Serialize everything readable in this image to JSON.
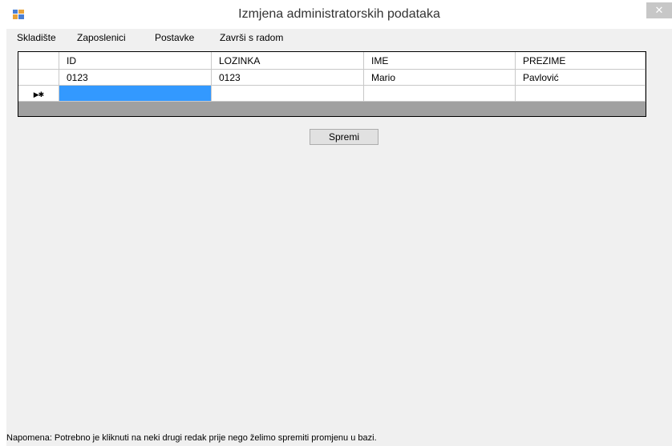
{
  "window": {
    "title": "Izmjena administratorskih podataka",
    "close_glyph": "✕"
  },
  "menu": [
    {
      "label": "Skladište"
    },
    {
      "label": "Zaposlenici"
    },
    {
      "label": "Postavke"
    },
    {
      "label": "Završi s radom"
    }
  ],
  "grid": {
    "columns": [
      "ID",
      "LOZINKA",
      "IME",
      "PREZIME"
    ],
    "rows": [
      [
        "0123",
        "0123",
        "Mario",
        "Pavlović"
      ]
    ],
    "new_row_marker": "▶✱"
  },
  "buttons": {
    "save_label": "Spremi"
  },
  "note": "Napomena: Potrebno je kliknuti na neki drugi redak prije nego želimo spremiti promjenu u bazi.",
  "colors": {
    "selected_cell": "#3399ff",
    "grid_background": "#a0a0a0",
    "window_background": "#f0f0f0"
  },
  "icons": {
    "app": "application-window-icon",
    "close": "close-icon"
  }
}
